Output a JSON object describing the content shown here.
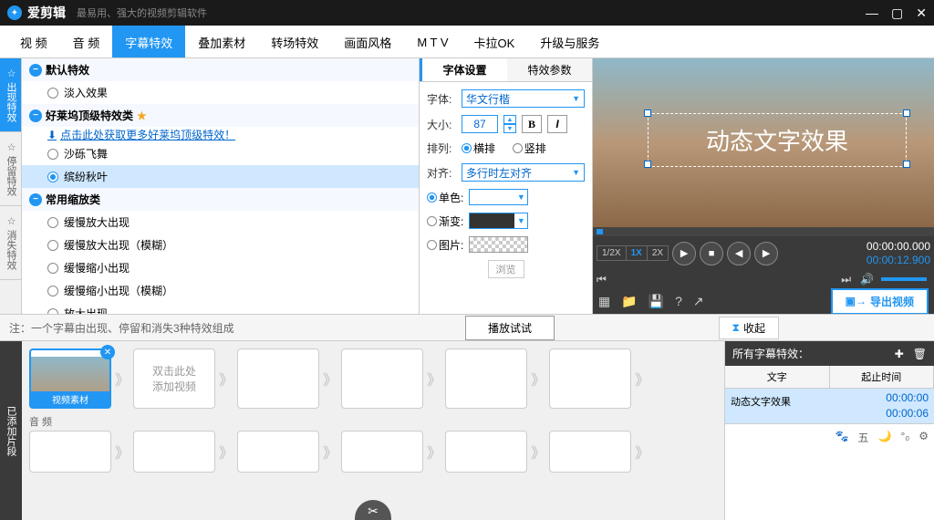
{
  "app": {
    "name": "爱剪辑",
    "tagline": "最易用、强大的视频剪辑软件"
  },
  "tabs": [
    "视 频",
    "音 频",
    "字幕特效",
    "叠加素材",
    "转场特效",
    "画面风格",
    "M T V",
    "卡拉OK",
    "升级与服务"
  ],
  "activeTab": 2,
  "sideTabs": [
    "出现特效",
    "停留特效",
    "消失特效"
  ],
  "effects": {
    "g1": {
      "title": "默认特效",
      "items": [
        "淡入效果"
      ]
    },
    "g2": {
      "title": "好莱坞顶级特效类",
      "link": "点击此处获取更多好莱坞顶级特效！",
      "items": [
        "沙砾飞舞",
        "缤纷秋叶"
      ],
      "selected": 1
    },
    "g3": {
      "title": "常用缩放类",
      "items": [
        "缓慢放大出现",
        "缓慢放大出现（模糊）",
        "缓慢缩小出现",
        "缓慢缩小出现（模糊）",
        "放大出现"
      ]
    }
  },
  "fontPanel": {
    "tabs": [
      "字体设置",
      "特效参数"
    ],
    "fontLabel": "字体:",
    "fontValue": "华文行楷",
    "sizeLabel": "大小:",
    "sizeValue": "87",
    "arrangeLabel": "排列:",
    "horiz": "横排",
    "vert": "竖排",
    "alignLabel": "对齐:",
    "alignValue": "多行时左对齐",
    "solid": "单色:",
    "gradient": "渐变:",
    "image": "图片:",
    "browse": "浏览"
  },
  "preview": {
    "text": "动态文字效果"
  },
  "speeds": [
    "1/2X",
    "1X",
    "2X"
  ],
  "timecode": {
    "pos": "00:00:00.000",
    "dur": "00:00:12.900"
  },
  "export": "导出视频",
  "note": "注：一个字幕由出现、停留和消失3种特效组成",
  "collapse": "收起",
  "playTest": "播放试试",
  "timeline": {
    "side": "已添加片段",
    "filled": "视频素材",
    "hint": "双击此处\n添加视频",
    "audio": "音 频"
  },
  "subPanel": {
    "title": "所有字幕特效：",
    "cols": [
      "文字",
      "起止时间"
    ],
    "row": {
      "text": "动态文字效果",
      "start": "00:00:00",
      "end": "00:00:06"
    },
    "icons": [
      "🐾",
      "五",
      "🌙",
      "°₀",
      "⚙"
    ]
  }
}
